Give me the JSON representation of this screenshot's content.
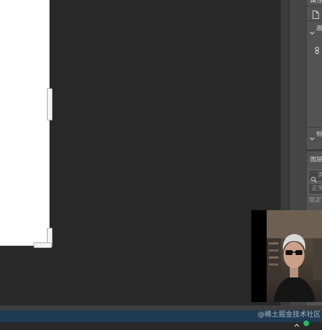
{
  "properties_panel": {
    "title": "属性",
    "section1_label": "画",
    "section2_label": "标",
    "doc_icon": "document-icon",
    "link_icon": "link-icon"
  },
  "layers_panel": {
    "title": "图层",
    "search_icon": "search-icon",
    "search_text": "类",
    "blend_mode": "正常",
    "lock_label": "锁定:"
  },
  "watermark": "@稀土掘金技术社区",
  "colors": {
    "canvas_bg": "#282828",
    "panel_bg": "#535353",
    "taskbar": "#1e3a52"
  }
}
